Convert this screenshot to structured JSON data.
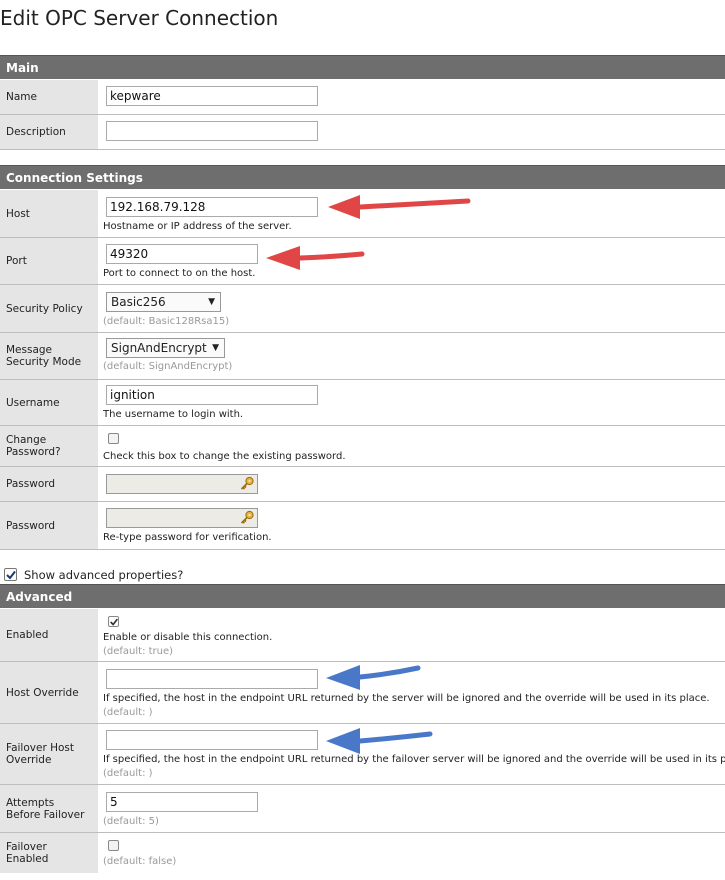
{
  "page_title": "Edit OPC Server Connection",
  "sections": {
    "main": "Main",
    "connection": "Connection Settings",
    "advanced": "Advanced"
  },
  "main": {
    "name_label": "Name",
    "name_value": "kepware",
    "description_label": "Description",
    "description_value": ""
  },
  "connection": {
    "host_label": "Host",
    "host_value": "192.168.79.128",
    "host_help": "Hostname or IP address of the server.",
    "port_label": "Port",
    "port_value": "49320",
    "port_help": "Port to connect to on the host.",
    "security_policy_label": "Security Policy",
    "security_policy_value": "Basic256",
    "security_policy_default": "(default: Basic128Rsa15)",
    "message_security_label_1": "Message",
    "message_security_label_2": "Security Mode",
    "message_security_value": "SignAndEncrypt",
    "message_security_default": "(default: SignAndEncrypt)",
    "username_label": "Username",
    "username_value": "ignition",
    "username_help": "The username to login with.",
    "change_password_label_1": "Change",
    "change_password_label_2": "Password?",
    "change_password_checked": false,
    "change_password_help": "Check this box to change the existing password.",
    "password_label": "Password",
    "password_retype_label": "Password",
    "password_retype_help": "Re-type password for verification."
  },
  "show_advanced": {
    "label": "Show advanced properties?",
    "checked": true
  },
  "advanced": {
    "enabled_label": "Enabled",
    "enabled_checked": true,
    "enabled_help": "Enable or disable this connection.",
    "enabled_default": "(default: true)",
    "host_override_label": "Host Override",
    "host_override_value": "",
    "host_override_help": "If specified, the host in the endpoint URL returned by the server will be ignored and the override will be used in its place.",
    "host_override_default": "(default: )",
    "failover_host_label_1": "Failover Host",
    "failover_host_label_2": "Override",
    "failover_host_value": "",
    "failover_host_help": "If specified, the host in the endpoint URL returned by the failover server will be ignored and the override will be used in its place.",
    "failover_host_default": "(default: )",
    "attempts_label_1": "Attempts",
    "attempts_label_2": "Before Failover",
    "attempts_value": "5",
    "attempts_default": "(default: 5)",
    "failover_enabled_label_1": "Failover",
    "failover_enabled_label_2": "Enabled",
    "failover_enabled_checked": false,
    "failover_enabled_default": "(default: false)"
  },
  "icons": {
    "key": "key-icon",
    "checkmark": "checkmark-icon",
    "dropdown": "chevron-down-icon"
  },
  "colors": {
    "section_header": "#6e6e6e",
    "label_column": "#e5e5e5",
    "red_annotation": "#e04646",
    "blue_annotation": "#4a78c8"
  }
}
